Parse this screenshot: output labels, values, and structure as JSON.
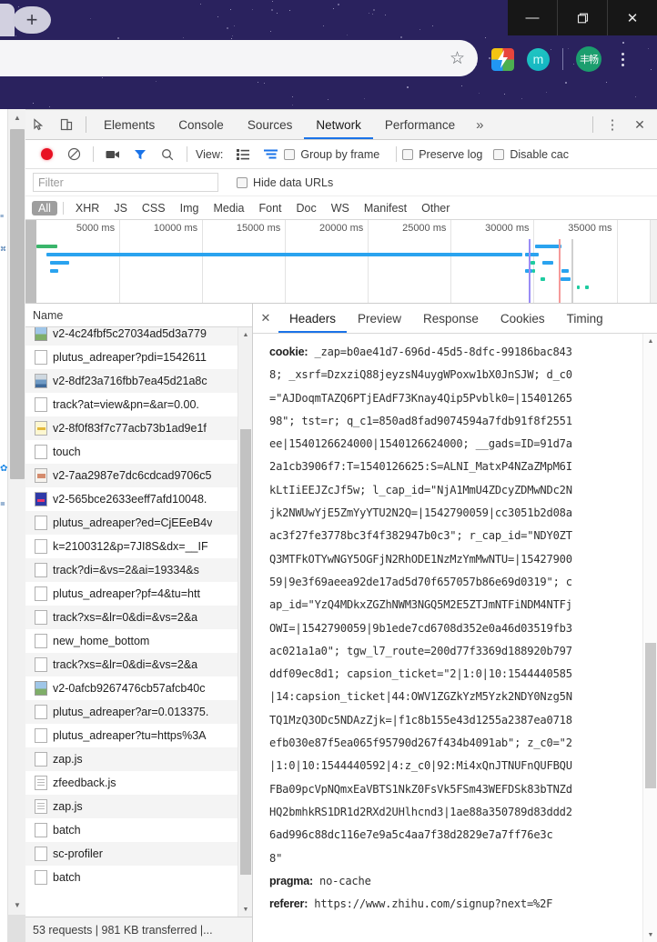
{
  "browser": {
    "new_tab_label": "+",
    "window_controls": [
      {
        "name": "minimize",
        "glyph": "—"
      },
      {
        "name": "restore",
        "glyph": "❐"
      },
      {
        "name": "close",
        "glyph": "✕"
      }
    ],
    "omnibox_value": "",
    "omnibox_placeholder": "",
    "bookmark_icon": "☆",
    "extension_m_label": "m",
    "avatar_label": "丰畅",
    "background_color": "#2a225e"
  },
  "devtools": {
    "tabs": [
      {
        "label": "Elements",
        "active": false
      },
      {
        "label": "Console",
        "active": false
      },
      {
        "label": "Sources",
        "active": false
      },
      {
        "label": "Network",
        "active": true
      },
      {
        "label": "Performance",
        "active": false
      }
    ],
    "more_tabs_glyph": "»",
    "menu_glyph": "⋮",
    "close_glyph": "✕",
    "accent_color": "#1a73e8",
    "toolbar": {
      "record_title": "record-button",
      "clear_title": "clear-button",
      "camera_title": "screenshots-button",
      "filter_title": "filter-button",
      "search_title": "search-button",
      "view_label": "View:",
      "group_by_frame": "Group by frame",
      "preserve_log": "Preserve log",
      "disable_cache": "Disable cac"
    },
    "filter": {
      "value": "",
      "placeholder": "Filter",
      "hide_data_urls": "Hide data URLs"
    },
    "types": [
      "All",
      "XHR",
      "JS",
      "CSS",
      "Img",
      "Media",
      "Font",
      "Doc",
      "WS",
      "Manifest",
      "Other"
    ],
    "selected_type": "All",
    "status": "53 requests  |  981 KB transferred  |..."
  },
  "chart_data": {
    "type": "timeline",
    "title": "Network overview waterfall",
    "xlabel": "ms",
    "axis_ticks": [
      "5000 ms",
      "10000 ms",
      "15000 ms",
      "20000 ms",
      "25000 ms",
      "30000 ms",
      "35000 ms"
    ],
    "xlim": [
      0,
      37000
    ],
    "grid": true,
    "event_lines": [
      {
        "name": "DOMContentLoaded",
        "value": 29700,
        "color": "#9a8cf5"
      },
      {
        "name": "Load",
        "value": 31500,
        "color": "#f59a9a"
      },
      {
        "name": "gray-marker",
        "value": 32300,
        "color": "#d0d0d0"
      }
    ],
    "bars": [
      {
        "start": 0,
        "end": 1250,
        "row": 0,
        "color": "#3ab56b"
      },
      {
        "start": 600,
        "end": 29300,
        "row": 1,
        "color": "#2aa3ef"
      },
      {
        "start": 800,
        "end": 2000,
        "row": 2,
        "color": "#2aa3ef"
      },
      {
        "start": 800,
        "end": 1300,
        "row": 3,
        "color": "#2aa3ef"
      },
      {
        "start": 29500,
        "end": 30000,
        "row": 1,
        "color": "#2aa3ef"
      },
      {
        "start": 30100,
        "end": 31700,
        "row": 0,
        "color": "#2aa3ef"
      },
      {
        "start": 29600,
        "end": 30300,
        "row": 1,
        "color": "#2aa3ef"
      },
      {
        "start": 29800,
        "end": 30100,
        "row": 2,
        "color": "#1ecba0"
      },
      {
        "start": 30500,
        "end": 31200,
        "row": 2,
        "color": "#2aa3ef"
      },
      {
        "start": 29500,
        "end": 29900,
        "row": 3,
        "color": "#2aa3ef"
      },
      {
        "start": 29900,
        "end": 30100,
        "row": 3,
        "color": "#1ecba0"
      },
      {
        "start": 31700,
        "end": 32100,
        "row": 3,
        "color": "#2aa3ef"
      },
      {
        "start": 30400,
        "end": 30700,
        "row": 4,
        "color": "#1ecba0"
      },
      {
        "start": 31600,
        "end": 32200,
        "row": 4,
        "color": "#2aa3ef"
      },
      {
        "start": 32600,
        "end": 32800,
        "row": 5,
        "color": "#1ecba0"
      },
      {
        "start": 33100,
        "end": 33300,
        "row": 5,
        "color": "#1ecba0"
      }
    ]
  },
  "requests": {
    "column_header": "Name",
    "rows": [
      {
        "name": "v2-4c24fbf5c27034ad5d3a779",
        "icon": "image-file-icon"
      },
      {
        "name": "plutus_adreaper?pdi=1542611",
        "icon": "generic-file-icon"
      },
      {
        "name": "v2-8df23a716fbb7ea45d21a8c",
        "icon": "image-file-icon"
      },
      {
        "name": "track?at=view&pn=&ar=0.00.",
        "icon": "generic-file-icon"
      },
      {
        "name": "v2-8f0f83f7c77acb73b1ad9e1f",
        "icon": "image-file-icon"
      },
      {
        "name": "touch",
        "icon": "generic-file-icon"
      },
      {
        "name": "v2-7aa2987e7dc6cdcad9706c5",
        "icon": "image-file-icon"
      },
      {
        "name": "v2-565bce2633eeff7afd10048.",
        "icon": "image-file-icon"
      },
      {
        "name": "plutus_adreaper?ed=CjEEeB4v",
        "icon": "generic-file-icon"
      },
      {
        "name": "k=2100312&p=7JI8S&dx=__IF",
        "icon": "generic-file-icon"
      },
      {
        "name": "track?di=&vs=2&ai=19334&s",
        "icon": "generic-file-icon"
      },
      {
        "name": "plutus_adreaper?pf=4&tu=htt",
        "icon": "generic-file-icon"
      },
      {
        "name": "track?xs=&lr=0&di=&vs=2&a",
        "icon": "generic-file-icon"
      },
      {
        "name": "new_home_bottom",
        "icon": "generic-file-icon"
      },
      {
        "name": "track?xs=&lr=0&di=&vs=2&a",
        "icon": "generic-file-icon"
      },
      {
        "name": "v2-0afcb9267476cb57afcb40c",
        "icon": "image-file-icon"
      },
      {
        "name": "plutus_adreaper?ar=0.013375.",
        "icon": "generic-file-icon"
      },
      {
        "name": "plutus_adreaper?tu=https%3A",
        "icon": "generic-file-icon"
      },
      {
        "name": "zap.js",
        "icon": "generic-file-icon"
      },
      {
        "name": "zfeedback.js",
        "icon": "script-file-icon"
      },
      {
        "name": "zap.js",
        "icon": "script-file-icon"
      },
      {
        "name": "batch",
        "icon": "generic-file-icon"
      },
      {
        "name": "sc-profiler",
        "icon": "generic-file-icon"
      },
      {
        "name": "batch",
        "icon": "generic-file-icon"
      }
    ]
  },
  "details": {
    "close_glyph": "✕",
    "tabs": [
      {
        "label": "Headers",
        "active": true
      },
      {
        "label": "Preview",
        "active": false
      },
      {
        "label": "Response",
        "active": false
      },
      {
        "label": "Cookies",
        "active": false
      },
      {
        "label": "Timing",
        "active": false
      }
    ],
    "headers": [
      {
        "key": "cookie:",
        "lines": [
          "_zap=b0ae41d7-696d-45d5-8dfc-99186bac843",
          "8; _xsrf=DzxziQ88jeyzsN4uygWPoxw1bX0JnSJW; d_c0",
          "=\"AJDoqmTAZQ6PTjEAdF73Knay4Qip5Pvblk0=|15401265",
          "98\"; tst=r; q_c1=850ad8fad9074594a7fdb91f8f2551",
          "ee|1540126624000|1540126624000; __gads=ID=91d7a",
          "2a1cb3906f7:T=1540126625:S=ALNI_MatxP4NZaZMpM6I",
          "kLtIiEEJZcJf5w; l_cap_id=\"NjA1MmU4ZDcyZDMwNDc2N",
          "jk2NWUwYjE5ZmYyYTU2N2Q=|1542790059|cc3051b2d08a",
          "ac3f27fe3778bc3f4f382947b0c3\"; r_cap_id=\"NDY0ZT",
          "Q3MTFkOTYwNGY5OGFjN2RhODE1NzMzYmMwNTU=|15427900",
          "59|9e3f69aeea92de17ad5d70f657057b86e69d0319\"; c",
          "ap_id=\"YzQ4MDkxZGZhNWM3NGQ5M2E5ZTJmNTFiNDM4NTFj",
          "OWI=|1542790059|9b1ede7cd6708d352e0a46d03519fb3",
          "ac021a1a0\"; tgw_l7_route=200d77f3369d188920b797",
          "ddf09ec8d1; capsion_ticket=\"2|1:0|10:1544440585",
          "|14:capsion_ticket|44:OWV1ZGZkYzM5Yzk2NDY0Nzg5N",
          "TQ1MzQ3ODc5NDAzZjk=|f1c8b155e43d1255a2387ea0718",
          "efb030e87f5ea065f95790d267f434b4091ab\"; z_c0=\"2",
          "|1:0|10:1544440592|4:z_c0|92:Mi4xQnJTNUFnQUFBQU",
          "FBa09pcVpNQmxEaVBTS1NkZ0FsVk5FSm43WEFDSk83bTNZd",
          "HQ2bmhkRS1DR1d2RXd2UHlhcnd3|1ae88a350789d83ddd2",
          "6ad996c88dc116e7e9a5c4aa7f38d2829e7a7ff76e3c",
          "8\""
        ]
      },
      {
        "key": "pragma:",
        "lines": [
          "no-cache"
        ]
      },
      {
        "key": "referer:",
        "lines": [
          "https://www.zhihu.com/signup?next=%2F"
        ]
      }
    ]
  }
}
